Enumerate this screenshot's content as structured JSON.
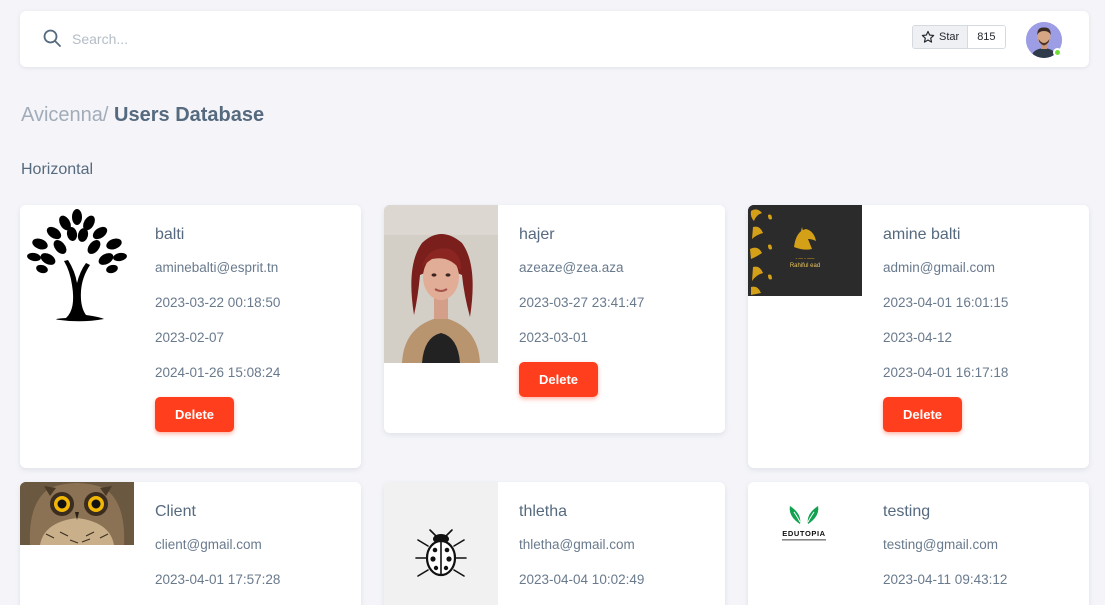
{
  "header": {
    "search_placeholder": "Search...",
    "star_label": "Star",
    "star_count": "815"
  },
  "breadcrumb": {
    "parent": "Avicenna/",
    "current": "Users Database"
  },
  "section_title": "Horizontal",
  "colors": {
    "delete": "#ff3e1d",
    "online": "#71dd37",
    "text": "#566a7f"
  },
  "users": [
    {
      "name": "balti",
      "email": "aminebalti@esprit.tn",
      "created": "2023-03-22 00:18:50",
      "date": "2023-02-07",
      "updated": "2024-01-26 15:08:24",
      "delete_label": "Delete",
      "image": "tree-logo"
    },
    {
      "name": "hajer",
      "email": "azeaze@zea.aza",
      "created": "2023-03-27 23:41:47",
      "date": "2023-03-01",
      "delete_label": "Delete",
      "image": "portrait-photo"
    },
    {
      "name": "amine balti",
      "email": "admin@gmail.com",
      "created": "2023-04-01 16:01:15",
      "date": "2023-04-12",
      "updated": "2023-04-01 16:17:18",
      "delete_label": "Delete",
      "image": "calligraphy-logo"
    },
    {
      "name": "Client",
      "email": "client@gmail.com",
      "created": "2023-04-01 17:57:28",
      "image": "owl-photo"
    },
    {
      "name": "thletha",
      "email": "thletha@gmail.com",
      "created": "2023-04-04 10:02:49",
      "image": "ladybug-icon"
    },
    {
      "name": "testing",
      "email": "testing@gmail.com",
      "created": "2023-04-11 09:43:12",
      "image": "edutopia-logo"
    }
  ],
  "logos": {
    "calligraphy_caption": "Rahiful ead",
    "edutopia_caption": "EDUTOPIA"
  }
}
